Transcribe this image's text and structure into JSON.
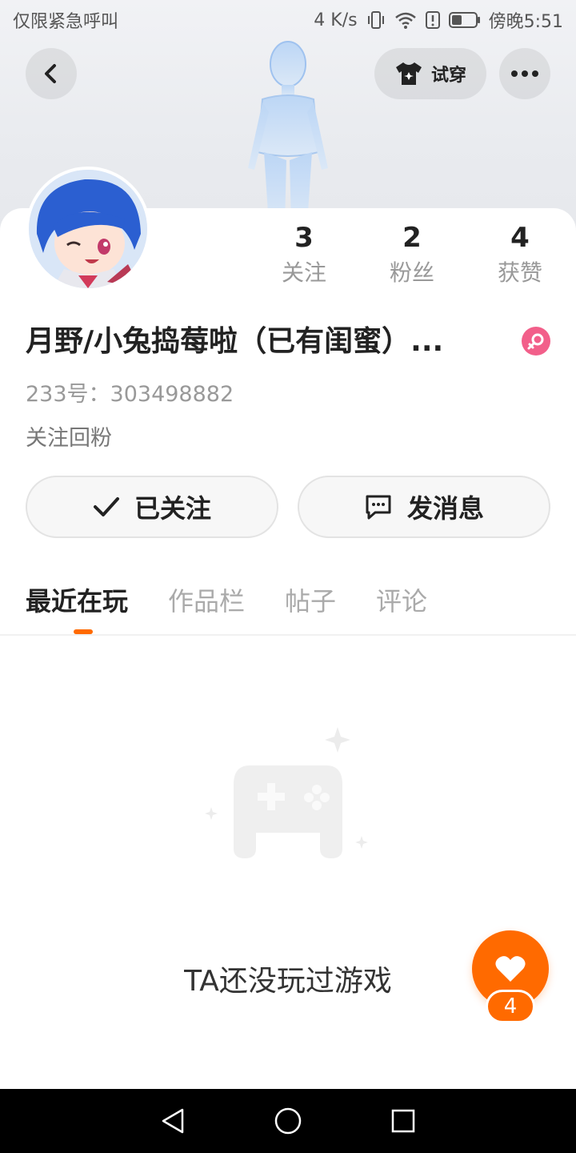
{
  "status_bar": {
    "left_text": "仅限紧急呼叫",
    "net_speed": "4 K/s",
    "time": "傍晚5:51"
  },
  "header": {
    "back_icon": "chevron-left-icon",
    "try_on_label": "试穿",
    "more_icon": "more-dots-icon"
  },
  "profile": {
    "nickname": "月野/小兔捣莓啦（已有闺蜜）...",
    "gender": "female",
    "uid": "233号：303498882",
    "bio": "关注回粉",
    "stats": [
      {
        "value": "3",
        "label": "关注"
      },
      {
        "value": "2",
        "label": "粉丝"
      },
      {
        "value": "4",
        "label": "获赞"
      }
    ]
  },
  "actions": {
    "follow_label": "已关注",
    "message_label": "发消息"
  },
  "tabs": [
    "最近在玩",
    "作品栏",
    "帖子",
    "评论"
  ],
  "empty_state": {
    "text": "TA还没玩过游戏"
  },
  "like": {
    "count": "4"
  },
  "colors": {
    "accent": "#ff6a00",
    "gender_badge": "#f25f8a"
  }
}
